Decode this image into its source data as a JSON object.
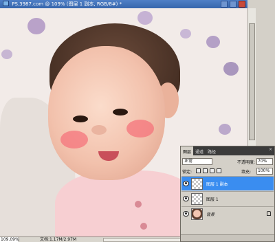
{
  "window": {
    "title": "PS.3987.com @ 109% (图层 1 副本, RGB/8#) *",
    "icon": "photoshop-icon"
  },
  "statusbar": {
    "zoom": "109.09%",
    "doc_info": "文档:1.17M/2.97M"
  },
  "layers_panel": {
    "tabs": [
      "图层",
      "通道",
      "路径"
    ],
    "active_tab": "图层",
    "blend_mode": "正常",
    "opacity_label": "不透明度:",
    "opacity_value": "70%",
    "lock_label": "锁定:",
    "fill_label": "填充:",
    "fill_value": "100%",
    "layers": [
      {
        "name": "图层 1 副本",
        "selected": true,
        "visible": true,
        "thumbnail": "transparent"
      },
      {
        "name": "图层 1",
        "selected": false,
        "visible": true,
        "thumbnail": "transparent"
      },
      {
        "name": "背景",
        "selected": false,
        "visible": true,
        "thumbnail": "photo",
        "locked": true
      }
    ]
  },
  "colors": {
    "selected_layer": "#3a8df0",
    "title_bar": "#3766ad",
    "cheek_blush": "#f56e78"
  }
}
